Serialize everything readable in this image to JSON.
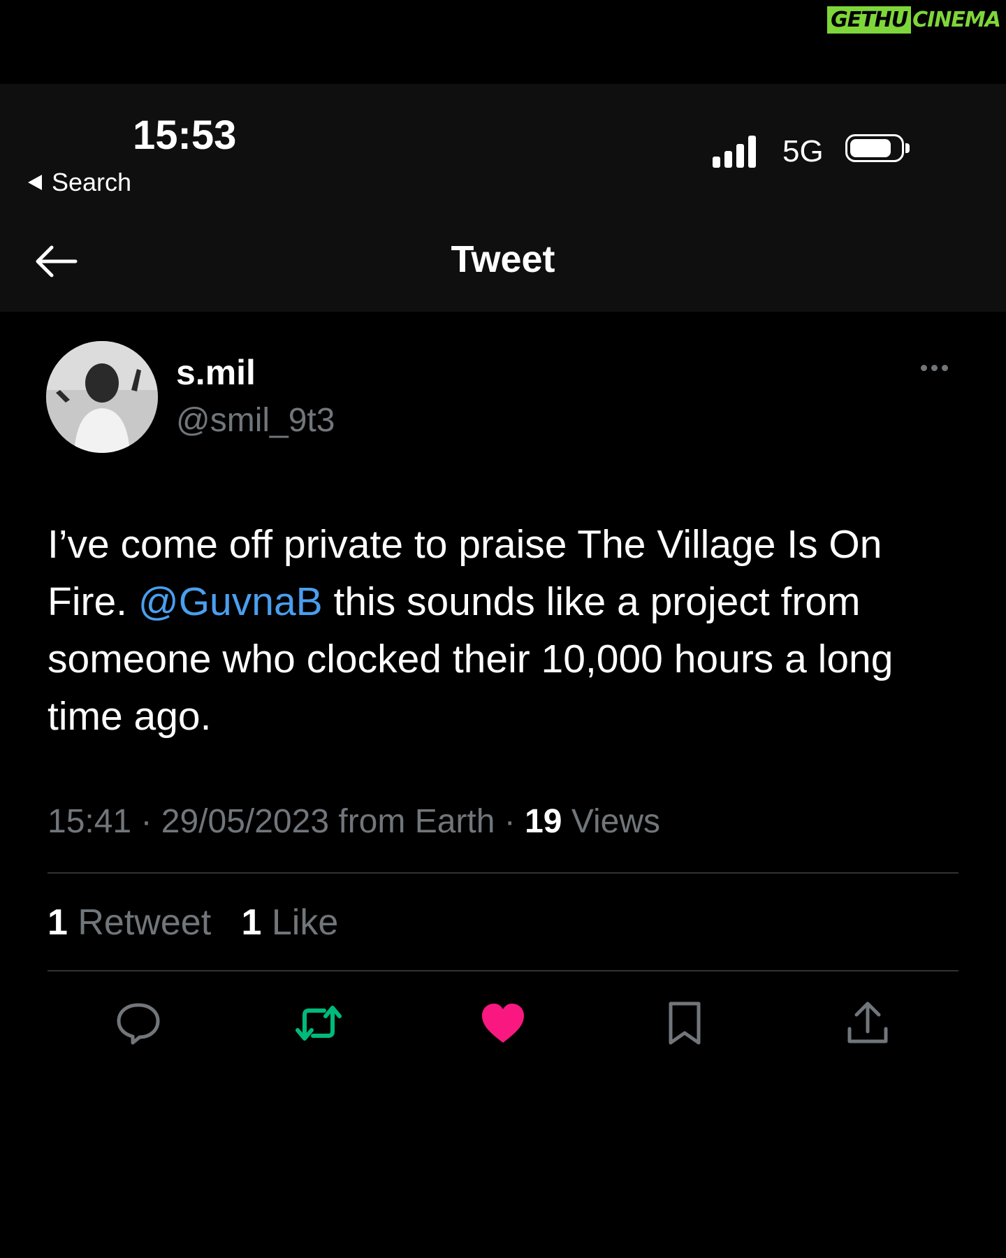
{
  "watermark": {
    "part1": "GETHU",
    "part2": "CINEMA"
  },
  "status_bar": {
    "time": "15:53",
    "back_label": "Search",
    "network": "5G"
  },
  "nav": {
    "title": "Tweet"
  },
  "tweet": {
    "display_name": "s.mil",
    "handle": "@smil_9t3",
    "text_before": "I’ve come off private to praise The Village Is On Fire. ",
    "mention": "@GuvnaB",
    "text_after": " this sounds like a project from someone who clocked their 10,000 hours a long time ago.",
    "time": "15:41",
    "date": "29/05/2023",
    "source": "from Earth",
    "views_count": "19",
    "views_label": "Views",
    "retweets_count": "1",
    "retweets_label": "Retweet",
    "likes_count": "1",
    "likes_label": "Like"
  },
  "colors": {
    "background": "#000000",
    "mention": "#4a9eef",
    "retweet": "#00ba7c",
    "like": "#f91880",
    "muted": "#71767b"
  },
  "actions": [
    {
      "name": "reply-icon"
    },
    {
      "name": "retweet-icon",
      "active": true
    },
    {
      "name": "like-icon",
      "active": true
    },
    {
      "name": "bookmark-icon"
    },
    {
      "name": "share-icon"
    }
  ]
}
